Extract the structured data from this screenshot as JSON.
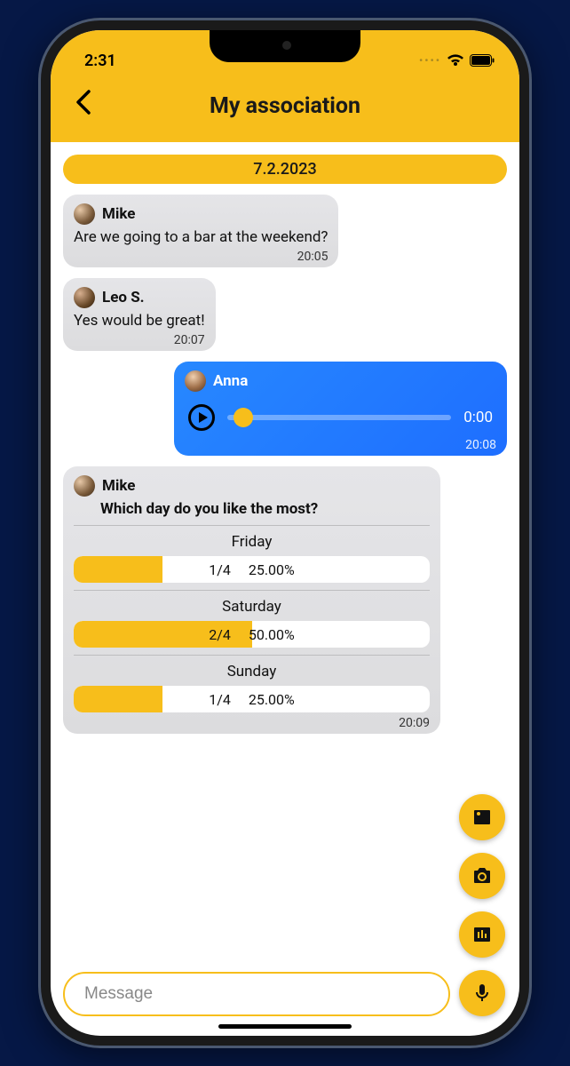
{
  "status": {
    "time": "2:31"
  },
  "header": {
    "title": "My association"
  },
  "date_chip": "7.2.2023",
  "messages": [
    {
      "sender": "Mike",
      "text": "Are we going to a bar at the weekend?",
      "time": "20:05"
    },
    {
      "sender": "Leo S.",
      "text": "Yes would be great!",
      "time": "20:07"
    },
    {
      "sender": "Anna",
      "audio_position": "0:00",
      "time": "20:08"
    },
    {
      "sender": "Mike",
      "poll_title": "Which day do you like the most?",
      "time": "20:09"
    }
  ],
  "poll": {
    "options": [
      {
        "label": "Friday",
        "count": "1/4",
        "percent": "25.00%",
        "fill": 25
      },
      {
        "label": "Saturday",
        "count": "2/4",
        "percent": "50.00%",
        "fill": 50
      },
      {
        "label": "Sunday",
        "count": "1/4",
        "percent": "25.00%",
        "fill": 25
      }
    ]
  },
  "composer": {
    "placeholder": "Message"
  }
}
